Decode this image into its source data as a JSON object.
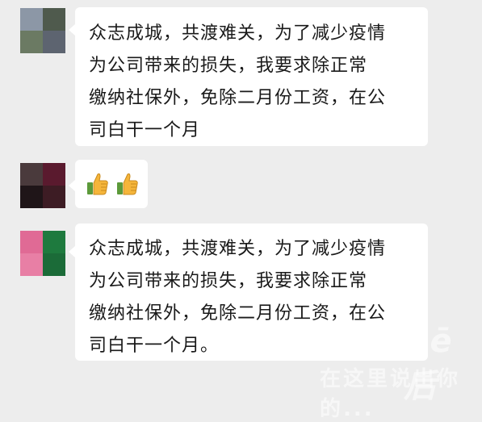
{
  "messages": [
    {
      "sender_avatar": "avatar-blurred-1",
      "text": "众志成城，共渡难关，为了减少疫情\n为公司带来的损失，我要求除正常\n缴纳社保外，免除二月份工资，在公\n司白干一个月"
    },
    {
      "sender_avatar": "avatar-blurred-2",
      "emoji": [
        "thumbs-up-icon",
        "thumbs-up-icon"
      ]
    },
    {
      "sender_avatar": "avatar-blurred-3",
      "text": "众志成城，共渡难关，为了减少疫情\n为公司带来的损失，我要求除正常\n缴纳社保外，免除二月份工资，在公\n司白干一个月。"
    }
  ],
  "watermark": {
    "logo": "Bē后",
    "text": "在这里说出你的..."
  },
  "colors": {
    "background": "#ededed",
    "bubble": "#ffffff",
    "avatar1": [
      "#8c97a6",
      "#4f5a4d",
      "#6b7a63",
      "#5d6470"
    ],
    "avatar2": [
      "#4a3a3c",
      "#5a1a2e",
      "#1f1518",
      "#3d1c24"
    ],
    "avatar3": [
      "#e06a95",
      "#1e7a3e",
      "#e87fa5",
      "#1b6b38"
    ]
  }
}
